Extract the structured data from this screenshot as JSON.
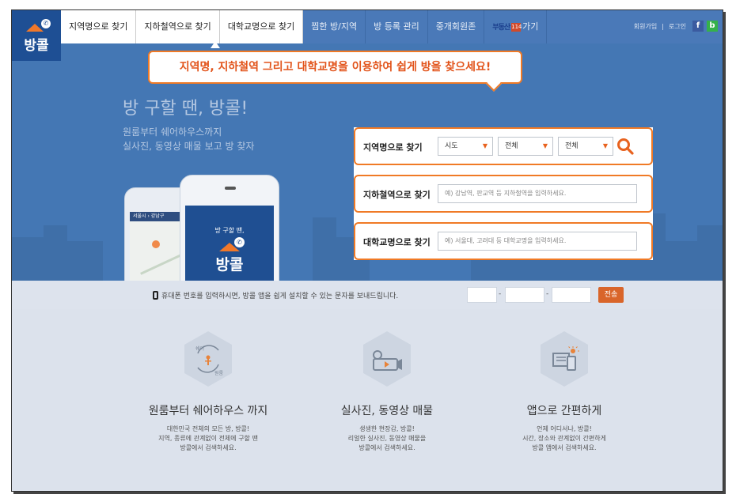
{
  "logo": {
    "text": "방콜"
  },
  "nav": {
    "tabs": [
      {
        "label": "지역명으로 찾기"
      },
      {
        "label": "지하철역으로 찾기"
      },
      {
        "label": "대학교명으로 찾기"
      },
      {
        "label": "찜한 방/지역"
      },
      {
        "label": "방 등록 관리"
      },
      {
        "label": "중개회원존"
      }
    ],
    "partner": {
      "brand": "부동산",
      "badge": "114",
      "suffix": "가기"
    },
    "signup": "회원가입",
    "login": "로그인",
    "facebook": "f",
    "blog": "b"
  },
  "callout": {
    "text": "지역명, 지하철역 그리고 대학교명을 이용하여 쉽게 방을 찾으세요!"
  },
  "hero": {
    "title": "방 구할 땐, 방콜!",
    "sub1": "원룸부터 쉐어하우스까지",
    "sub2": "실사진, 동영상 매물 보고 방 찾자"
  },
  "phone": {
    "back_bar": "서울시 › 강남구",
    "front_text": "방 구할 땐,",
    "front_logo": "방콜"
  },
  "search": {
    "region": {
      "label": "지역명으로 찾기",
      "select1": "시도",
      "select2": "전체",
      "select3": "전체"
    },
    "subway": {
      "label": "지하철역으로 찾기",
      "placeholder": "예) 강남역, 판교역 등 지하철역을 입력하세요."
    },
    "university": {
      "label": "대학교명으로 찾기",
      "placeholder": "예) 서울대, 고려대 등 대학교명을 입력하세요."
    }
  },
  "sms": {
    "text": "휴대폰 번호를 입력하시면, 방콜 앱을 쉽게 설치할 수 있는 문자를 보내드립니다.",
    "dash1": "-",
    "dash2": "-",
    "send": "전송"
  },
  "features": [
    {
      "title": "원룸부터 쉐어하우스 까지",
      "icon_top": "쉐어",
      "icon_bottom": "원룸",
      "desc1": "대한민국 전체의 모든 방, 방콜!",
      "desc2": "지역, 종류에 관계없이 전체에 구할 땐",
      "desc3": "방콜에서 검색하세요."
    },
    {
      "title": "실사진, 동영상 매물",
      "desc1": "생생한 현장감, 방콜!",
      "desc2": "리얼한 실사진, 동영상 매물을",
      "desc3": "방콜에서 검색하세요."
    },
    {
      "title": "앱으로 간편하게",
      "desc1": "언제 어디서나, 방콜!",
      "desc2": "시간, 장소와 관계없이 간편하게",
      "desc3": "방콜 앱에서 검색하세요."
    }
  ]
}
